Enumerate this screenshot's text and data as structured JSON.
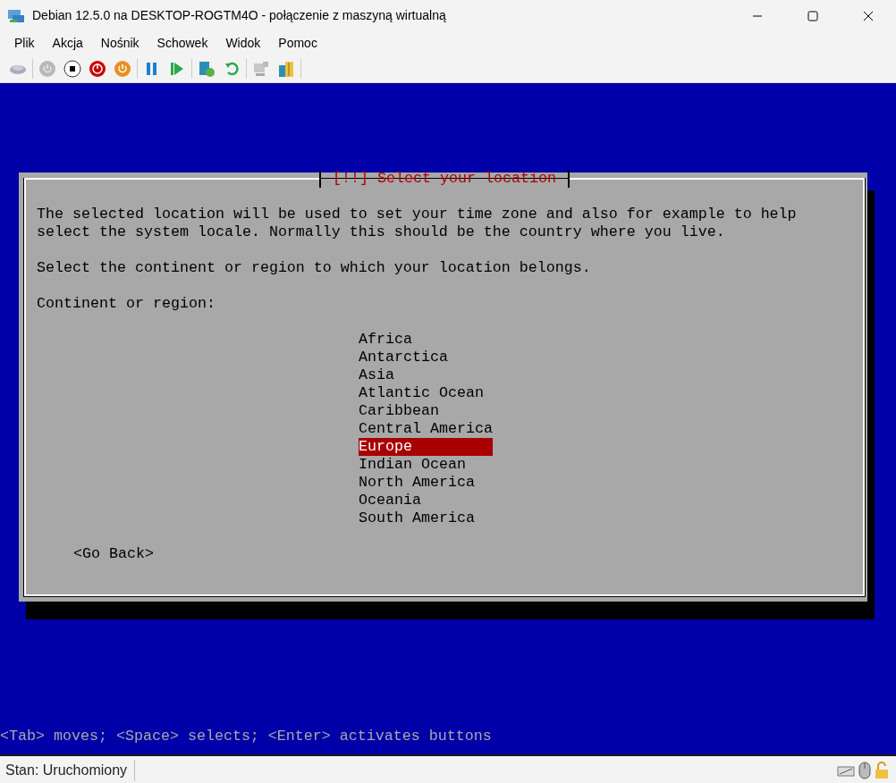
{
  "window": {
    "title": "Debian 12.5.0 na DESKTOP-ROGTM4O - połączenie z maszyną wirtualną"
  },
  "menu": [
    "Plik",
    "Akcja",
    "Nośnik",
    "Schowek",
    "Widok",
    "Pomoc"
  ],
  "console": {
    "dialog": {
      "title": "[!!] Select your location",
      "paragraphs": [
        "The selected location will be used to set your time zone and also for example to help\nselect the system locale. Normally this should be the country where you live.",
        "Select the continent or region to which your location belongs.",
        "Continent or region:"
      ],
      "options": [
        {
          "label": "Africa",
          "selected": false
        },
        {
          "label": "Antarctica",
          "selected": false
        },
        {
          "label": "Asia",
          "selected": false
        },
        {
          "label": "Atlantic Ocean",
          "selected": false
        },
        {
          "label": "Caribbean",
          "selected": false
        },
        {
          "label": "Central America",
          "selected": false
        },
        {
          "label": "Europe",
          "selected": true
        },
        {
          "label": "Indian Ocean",
          "selected": false
        },
        {
          "label": "North America",
          "selected": false
        },
        {
          "label": "Oceania",
          "selected": false
        },
        {
          "label": "South America",
          "selected": false
        }
      ],
      "back_button": "<Go Back>"
    },
    "hint": "<Tab> moves; <Space> selects; <Enter> activates buttons"
  },
  "status_bar": {
    "text": "Stan: Uruchomiony"
  }
}
